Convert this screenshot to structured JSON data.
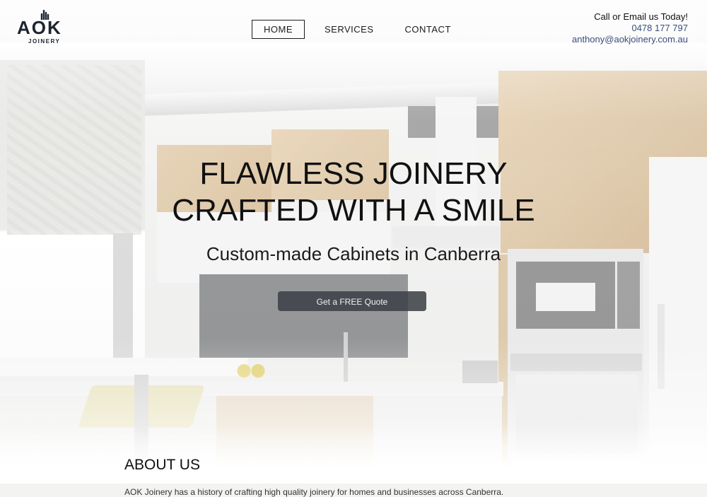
{
  "brand": {
    "logo_text": "AOK",
    "logo_sub": "JOINERY",
    "logo_icon": "hand-icon"
  },
  "nav": {
    "items": [
      {
        "label": "HOME",
        "active": true
      },
      {
        "label": "SERVICES",
        "active": false
      },
      {
        "label": "CONTACT",
        "active": false
      }
    ]
  },
  "contact": {
    "title": "Call or Email us Today!",
    "phone": "0478 177 797",
    "email": "anthony@aokjoinery.com.au"
  },
  "hero": {
    "title_line1": "FLAWLESS JOINERY",
    "title_line2": "CRAFTED WITH A SMILE",
    "subtitle": "Custom-made Cabinets in Canberra",
    "cta_label": "Get a FREE Quote"
  },
  "about": {
    "title": "ABOUT US",
    "text": "AOK Joinery has a history of crafting high quality joinery for homes and businesses across Canberra."
  },
  "colors": {
    "nav_text": "#1b1b1b",
    "link": "#3a4f7c",
    "cta_bg": "#3e4248"
  }
}
